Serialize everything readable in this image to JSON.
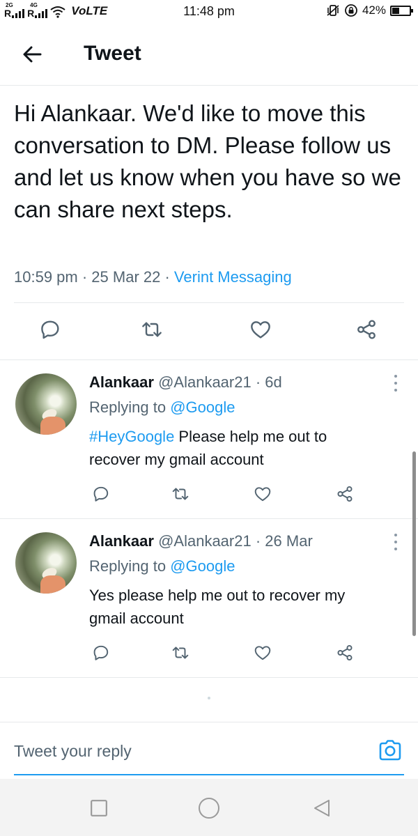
{
  "status_bar": {
    "network_2g": "2G",
    "network_4g": "4G",
    "volte": "VoLTE",
    "time": "11:48 pm",
    "battery_percent": "42%",
    "battery_level": 0.42
  },
  "header": {
    "title": "Tweet",
    "back_icon": "arrow-left-icon"
  },
  "main_tweet": {
    "text": "Hi Alankaar. We'd like to move this conversation to DM. Please follow us and let us know when you have so we can share next steps.",
    "time": "10:59 pm",
    "date": "25 Mar 22",
    "source": "Verint Messaging",
    "separator": " · "
  },
  "replies": [
    {
      "name": "Alankaar",
      "handle": "@Alankaar21",
      "time": "6d",
      "replying_label": "Replying to ",
      "replying_to": "@Google",
      "hashtag": "#HeyGoogle",
      "text": " Please help me out to recover my gmail account"
    },
    {
      "name": "Alankaar",
      "handle": "@Alankaar21",
      "time": "26 Mar",
      "replying_label": "Replying to ",
      "replying_to": "@Google",
      "hashtag": "",
      "text": "Yes please help me out to recover my gmail account"
    }
  ],
  "reply_bar": {
    "placeholder": "Tweet your reply",
    "camera_icon": "camera-icon"
  },
  "colors": {
    "accent": "#1d9bf0",
    "text": "#0f1419",
    "muted": "#536471",
    "icon": "#536471"
  }
}
